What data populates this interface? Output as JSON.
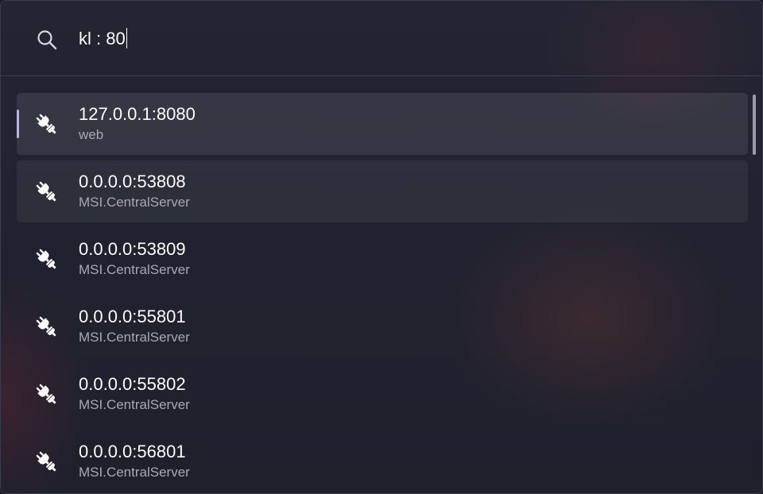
{
  "search": {
    "value": "kl : 80",
    "icon": "search-icon"
  },
  "results": [
    {
      "title": "127.0.0.1:8080",
      "subtitle": "web",
      "icon": "plug-icon",
      "state": "selected"
    },
    {
      "title": "0.0.0.0:53808",
      "subtitle": "MSI.CentralServer",
      "icon": "plug-icon",
      "state": "hover"
    },
    {
      "title": "0.0.0.0:53809",
      "subtitle": "MSI.CentralServer",
      "icon": "plug-icon",
      "state": ""
    },
    {
      "title": "0.0.0.0:55801",
      "subtitle": "MSI.CentralServer",
      "icon": "plug-icon",
      "state": ""
    },
    {
      "title": "0.0.0.0:55802",
      "subtitle": "MSI.CentralServer",
      "icon": "plug-icon",
      "state": ""
    },
    {
      "title": "0.0.0.0:56801",
      "subtitle": "MSI.CentralServer",
      "icon": "plug-icon",
      "state": ""
    }
  ],
  "colors": {
    "accent": "#b8b2f5",
    "text": "#ffffff",
    "subtext": "#a7a8b3"
  }
}
